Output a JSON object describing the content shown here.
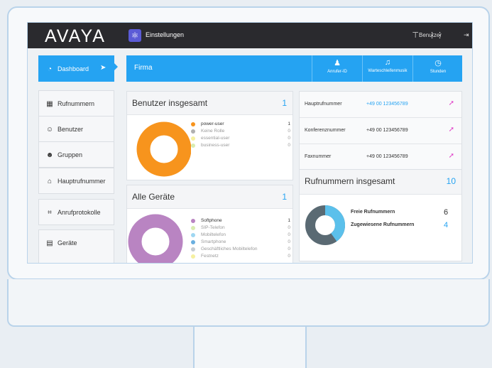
{
  "brand": {
    "logo": "AVAYA"
  },
  "app": {
    "title": "Einstellungen",
    "user": "Benutzer"
  },
  "sidebar": {
    "items": [
      {
        "label": "Dashboard",
        "icon": "gauge-icon"
      },
      {
        "label": "Rufnummern",
        "icon": "grid-icon"
      },
      {
        "label": "Benutzer",
        "icon": "user-icon"
      },
      {
        "label": "Gruppen",
        "icon": "group-icon"
      },
      {
        "label": "Hauptrufnummer",
        "icon": "home-icon"
      },
      {
        "label": "Anrufprotokolle",
        "icon": "log-icon"
      },
      {
        "label": "Geräte",
        "icon": "device-icon"
      }
    ]
  },
  "firma": {
    "label": "Firma",
    "buttons": [
      {
        "label": "Anrufer-ID",
        "icon": "person-icon"
      },
      {
        "label": "Warteschleifenmusik",
        "icon": "music-icon"
      },
      {
        "label": "Stunden",
        "icon": "clock-icon"
      }
    ]
  },
  "benutzer": {
    "title": "Benutzer insgesamt",
    "count": "1",
    "legend": [
      {
        "label": "power-user",
        "value": "1",
        "color": "#f7941d"
      },
      {
        "label": "Keine Rolle",
        "value": "0",
        "color": "#b0b0b0"
      },
      {
        "label": "essential-user",
        "value": "0",
        "color": "#f5f0a0"
      },
      {
        "label": "business-user",
        "value": "0",
        "color": "#d9ecb0"
      }
    ]
  },
  "geraete": {
    "title": "Alle Geräte",
    "count": "1",
    "legend": [
      {
        "label": "Softphone",
        "value": "1",
        "color": "#b984c2"
      },
      {
        "label": "SIP-Telefon",
        "value": "0",
        "color": "#d9ecb0"
      },
      {
        "label": "Mobiltelefon",
        "value": "0",
        "color": "#9fd7f2"
      },
      {
        "label": "Smartphone",
        "value": "0",
        "color": "#6aafe0"
      },
      {
        "label": "Geschäftliches Mobiltelefon",
        "value": "0",
        "color": "#c6ccd2"
      },
      {
        "label": "Festnetz",
        "value": "0",
        "color": "#f5f0a0"
      }
    ]
  },
  "numbers": [
    {
      "label": "Hauptrufnummer",
      "number": "+49 00 123456789",
      "highlight": true
    },
    {
      "label": "Konferenznummer",
      "number": "+49 00 123456789",
      "highlight": false
    },
    {
      "label": "Faxnummer",
      "number": "+49 00 123456789",
      "highlight": false
    }
  ],
  "rufnummern": {
    "title": "Rufnummern insgesamt",
    "count": "10",
    "items": [
      {
        "label": "Freie Rufnummern",
        "value": "6",
        "color": "#5a6a73"
      },
      {
        "label": "Zugewiesene Rufnummern",
        "value": "4",
        "color": "#5bc0eb"
      }
    ]
  },
  "colors": {
    "accent": "#25a3f2",
    "topbar": "#2a2a2e",
    "pin": "#e040c8"
  }
}
